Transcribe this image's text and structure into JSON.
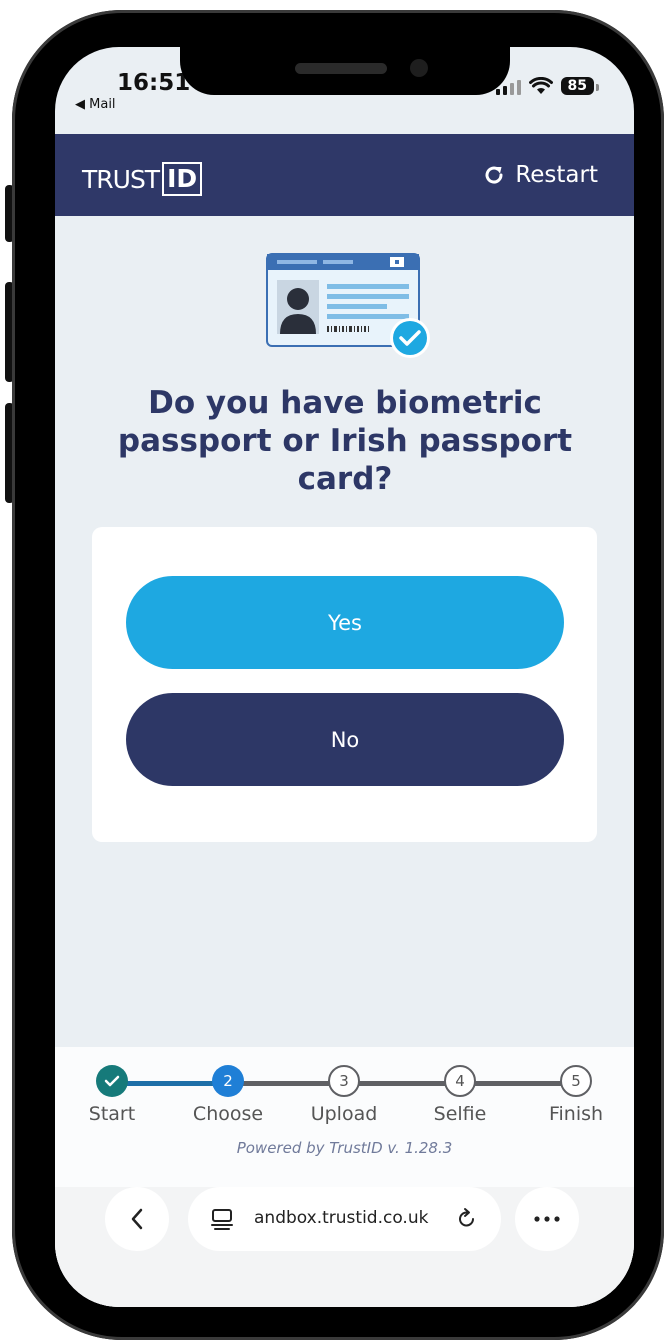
{
  "status_bar": {
    "time": "16:51",
    "back_app": "◀ Mail",
    "battery": "85"
  },
  "header": {
    "logo_text": "TRUST",
    "logo_box": "ID",
    "restart_label": "Restart"
  },
  "main": {
    "question": "Do you have biometric passport or Irish passport card?",
    "yes_label": "Yes",
    "no_label": "No"
  },
  "stepper": {
    "steps": [
      {
        "number": "1",
        "label": "Start",
        "state": "done"
      },
      {
        "number": "2",
        "label": "Choose",
        "state": "active"
      },
      {
        "number": "3",
        "label": "Upload",
        "state": "pending"
      },
      {
        "number": "4",
        "label": "Selfie",
        "state": "pending"
      },
      {
        "number": "5",
        "label": "Finish",
        "state": "pending"
      }
    ]
  },
  "footer": {
    "powered_by": "Powered by TrustID v. 1.28.3"
  },
  "browser": {
    "url": "andbox.trustid.co.uk"
  },
  "colors": {
    "navy": "#2d3766",
    "accent_blue": "#1ea8e1",
    "step_done": "#167a7a",
    "step_active": "#1f7fd6"
  }
}
